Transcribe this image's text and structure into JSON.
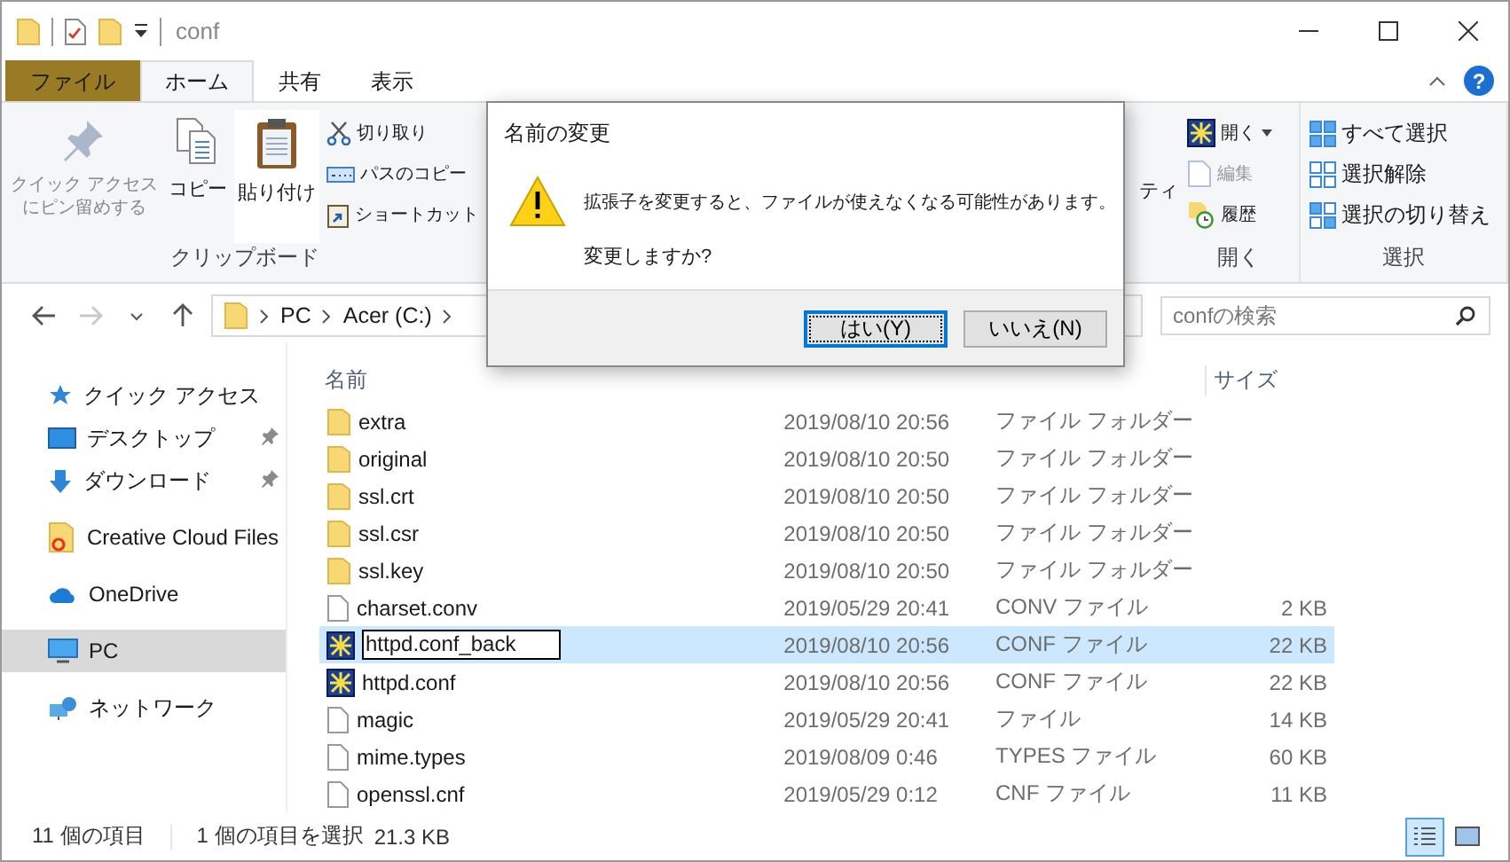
{
  "window": {
    "title": "conf"
  },
  "ribbon_tabs": [
    {
      "label": "ファイル",
      "kind": "file",
      "selected": false
    },
    {
      "label": "ホーム",
      "kind": "tab",
      "selected": true
    },
    {
      "label": "共有",
      "kind": "tab",
      "selected": false
    },
    {
      "label": "表示",
      "kind": "tab",
      "selected": false
    }
  ],
  "help_button": "?",
  "ribbon": {
    "pin_button": {
      "lines": [
        "クイック アクセス",
        "にピン留めする"
      ],
      "disabled": true
    },
    "copy_button": "コピー",
    "paste_button": "貼り付け",
    "small_buttons": [
      "切り取り",
      "パスのコピー",
      "ショートカット"
    ],
    "clipboard_label": "クリップボード",
    "properties_fragment": "ティ",
    "open_buttons": [
      {
        "label": "開く",
        "disabled": false
      },
      {
        "label": "編集",
        "disabled": true
      },
      {
        "label": "履歴",
        "disabled": false
      }
    ],
    "open_label": "開く",
    "select_buttons": [
      "すべて選択",
      "選択解除",
      "選択の切り替え"
    ],
    "select_label": "選択"
  },
  "nav_buttons": [
    {
      "kind": "back",
      "disabled": false
    },
    {
      "kind": "forward",
      "disabled": true
    },
    {
      "kind": "recent",
      "disabled": false
    },
    {
      "kind": "up",
      "disabled": false
    }
  ],
  "address": {
    "segments": [
      "PC",
      "Acer (C:)"
    ]
  },
  "search": {
    "placeholder": "confの検索"
  },
  "sidebar": {
    "items": [
      {
        "label": "クイック アクセス",
        "kind": "quick",
        "pinned": false,
        "selected": false
      },
      {
        "label": "デスクトップ",
        "kind": "desktop",
        "pinned": true,
        "selected": false
      },
      {
        "label": "ダウンロード",
        "kind": "download",
        "pinned": true,
        "selected": false
      },
      {
        "label": "Creative Cloud Files",
        "kind": "cloud-folder",
        "pinned": false,
        "selected": false
      },
      {
        "label": "OneDrive",
        "kind": "onedrive",
        "pinned": false,
        "selected": false
      },
      {
        "label": "PC",
        "kind": "pc",
        "pinned": false,
        "selected": true
      },
      {
        "label": "ネットワーク",
        "kind": "network",
        "pinned": false,
        "selected": false
      }
    ]
  },
  "file_list": {
    "name_header": "名前",
    "size_header": "サイズ",
    "rows": [
      {
        "name": "extra",
        "date": "2019/08/10 20:56",
        "type": "ファイル フォルダー",
        "kind": "folder",
        "selected": false,
        "renaming": false
      },
      {
        "name": "original",
        "date": "2019/08/10 20:50",
        "type": "ファイル フォルダー",
        "kind": "folder",
        "selected": false,
        "renaming": false
      },
      {
        "name": "ssl.crt",
        "date": "2019/08/10 20:50",
        "type": "ファイル フォルダー",
        "kind": "folder",
        "selected": false,
        "renaming": false
      },
      {
        "name": "ssl.csr",
        "date": "2019/08/10 20:50",
        "type": "ファイル フォルダー",
        "kind": "folder",
        "selected": false,
        "renaming": false
      },
      {
        "name": "ssl.key",
        "date": "2019/08/10 20:50",
        "type": "ファイル フォルダー",
        "kind": "folder",
        "selected": false,
        "renaming": false
      },
      {
        "name": "charset.conv",
        "date": "2019/05/29 20:41",
        "type": "CONV ファイル",
        "size": "2 KB",
        "kind": "file",
        "selected": false,
        "renaming": false
      },
      {
        "name": "httpd.conf_back",
        "date": "2019/08/10 20:56",
        "type": "CONF ファイル",
        "size": "22 KB",
        "kind": "config",
        "selected": true,
        "renaming": true
      },
      {
        "name": "httpd.conf",
        "date": "2019/08/10 20:56",
        "type": "CONF ファイル",
        "size": "22 KB",
        "kind": "config",
        "selected": false,
        "renaming": false
      },
      {
        "name": "magic",
        "date": "2019/05/29 20:41",
        "type": "ファイル",
        "size": "14 KB",
        "kind": "file",
        "selected": false,
        "renaming": false
      },
      {
        "name": "mime.types",
        "date": "2019/08/09 0:46",
        "type": "TYPES ファイル",
        "size": "60 KB",
        "kind": "file",
        "selected": false,
        "renaming": false
      },
      {
        "name": "openssl.cnf",
        "date": "2019/05/29 0:12",
        "type": "CNF ファイル",
        "size": "11 KB",
        "kind": "file",
        "selected": false,
        "renaming": false
      }
    ]
  },
  "status_bar": {
    "item_count": "11 個の項目",
    "selection": "1 個の項目を選択",
    "selection_size": "21.3 KB"
  },
  "view_buttons": [
    {
      "kind": "details",
      "selected": true
    },
    {
      "kind": "tiles",
      "selected": false
    }
  ],
  "dialog": {
    "title": "名前の変更",
    "message": "拡張子を変更すると、ファイルが使えなくなる可能性があります。",
    "question": "変更しますか?",
    "buttons": [
      {
        "label": "はい(Y)",
        "focused": true
      },
      {
        "label": "いいえ(N)",
        "focused": false
      }
    ]
  }
}
